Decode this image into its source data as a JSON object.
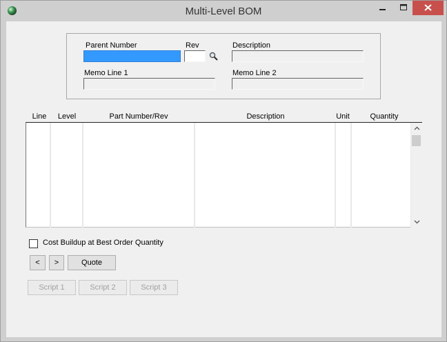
{
  "window": {
    "title": "Multi-Level BOM"
  },
  "header": {
    "parent_number_label": "Parent Number",
    "rev_label": "Rev",
    "description_label": "Description",
    "memo1_label": "Memo Line 1",
    "memo2_label": "Memo Line 2",
    "parent_number_value": "",
    "rev_value": "",
    "description_value": "",
    "memo1_value": "",
    "memo2_value": ""
  },
  "grid": {
    "columns": [
      "Line",
      "Level",
      "Part Number/Rev",
      "Description",
      "Unit",
      "Quantity"
    ],
    "rows": []
  },
  "options": {
    "cost_buildup_label": "Cost Buildup at Best Order Quantity",
    "cost_buildup_checked": false
  },
  "buttons": {
    "prev": "<",
    "next": ">",
    "quote": "Quote",
    "script1": "Script 1",
    "script2": "Script 2",
    "script3": "Script 3"
  },
  "icons": {
    "app": "app-globe-icon",
    "search": "magnifier-icon"
  }
}
